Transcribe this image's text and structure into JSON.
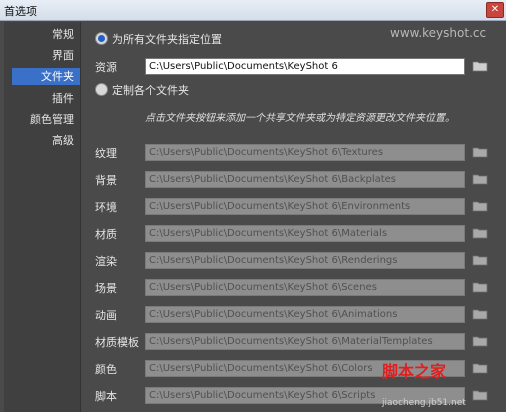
{
  "window": {
    "title": "首选项",
    "close_glyph": "✕"
  },
  "sidebar": {
    "items": [
      {
        "label": "常规",
        "selected": false
      },
      {
        "label": "界面",
        "selected": false
      },
      {
        "label": "文件夹",
        "selected": true
      },
      {
        "label": "插件",
        "selected": false
      },
      {
        "label": "颜色管理",
        "selected": false
      },
      {
        "label": "高级",
        "selected": false
      }
    ]
  },
  "options": {
    "all_folders_label": "为所有文件夹指定位置",
    "resources_label": "资源",
    "resources_path": "C:\\Users\\Public\\Documents\\KeyShot 6",
    "custom_label": "定制各个文件夹",
    "hint": "点击文件夹按钮来添加一个共享文件夹或为特定资源更改文件夹位置。"
  },
  "folders": [
    {
      "label": "纹理",
      "path": "C:\\Users\\Public\\Documents\\KeyShot 6\\Textures"
    },
    {
      "label": "背景",
      "path": "C:\\Users\\Public\\Documents\\KeyShot 6\\Backplates"
    },
    {
      "label": "环境",
      "path": "C:\\Users\\Public\\Documents\\KeyShot 6\\Environments"
    },
    {
      "label": "材质",
      "path": "C:\\Users\\Public\\Documents\\KeyShot 6\\Materials"
    },
    {
      "label": "渲染",
      "path": "C:\\Users\\Public\\Documents\\KeyShot 6\\Renderings"
    },
    {
      "label": "场景",
      "path": "C:\\Users\\Public\\Documents\\KeyShot 6\\Scenes"
    },
    {
      "label": "动画",
      "path": "C:\\Users\\Public\\Documents\\KeyShot 6\\Animations"
    },
    {
      "label": "材质模板",
      "path": "C:\\Users\\Public\\Documents\\KeyShot 6\\MaterialTemplates"
    },
    {
      "label": "颜色",
      "path": "C:\\Users\\Public\\Documents\\KeyShot 6\\Colors"
    },
    {
      "label": "脚本",
      "path": "C:\\Users\\Public\\Documents\\KeyShot 6\\Scripts"
    }
  ],
  "watermark": "www.keyshot.cc",
  "brand": {
    "text": "脚本之家",
    "sub": "jiaocheng.jb51.net"
  },
  "icons": {
    "folder": "folder-icon",
    "close": "close-icon",
    "radio": "radio-button"
  },
  "colors": {
    "selection": "#3a70c8",
    "background": "#4a4a4a",
    "brand": "#e02020"
  }
}
